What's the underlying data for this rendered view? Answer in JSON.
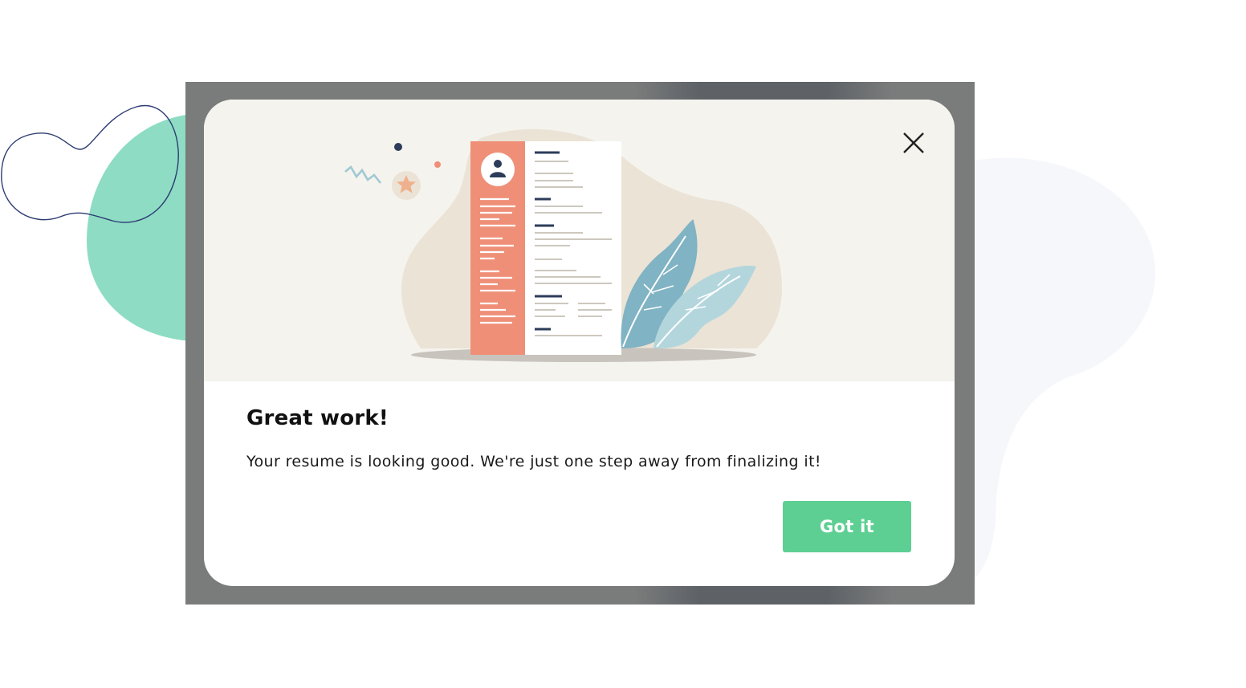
{
  "dialog": {
    "title": "Great work!",
    "message": "Your resume is looking good. We're just one step away from finalizing it!",
    "confirm_label": "Got it",
    "close_icon": "close-icon"
  },
  "illustration": {
    "subject": "resume-document",
    "icons": [
      "avatar-icon",
      "star-icon",
      "leaf-icon"
    ]
  },
  "colors": {
    "accent": "#5ecf93",
    "overlay": "#7a7b7b",
    "blob_green": "#8edcc4",
    "resume_sidebar": "#ef8f78",
    "leaf_dark": "#80b3c3",
    "leaf_light": "#b3d6dd",
    "illustration_bg": "#f5f3ee"
  }
}
